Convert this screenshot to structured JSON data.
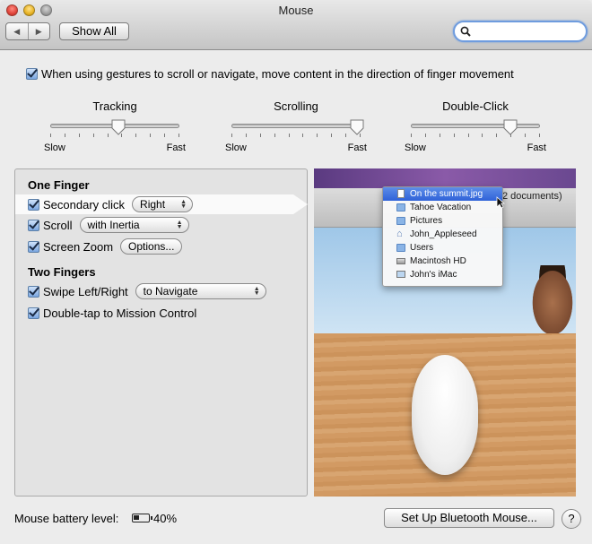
{
  "window": {
    "title": "Mouse",
    "show_all": "Show All",
    "back_glyph": "◀",
    "forward_glyph": "▶",
    "search_placeholder": ""
  },
  "natural_scroll": {
    "label": "When using gestures to scroll or navigate, move content in the direction of finger movement",
    "checked": true
  },
  "sliders": [
    {
      "title": "Tracking",
      "min_label": "Slow",
      "max_label": "Fast",
      "value_fraction": 0.53
    },
    {
      "title": "Scrolling",
      "min_label": "Slow",
      "max_label": "Fast",
      "value_fraction": 0.97
    },
    {
      "title": "Double-Click",
      "min_label": "Slow",
      "max_label": "Fast",
      "value_fraction": 0.77
    }
  ],
  "one_finger": {
    "heading": "One Finger",
    "secondary_click": {
      "label": "Secondary click",
      "value": "Right",
      "checked": true
    },
    "scroll": {
      "label": "Scroll",
      "value": "with Inertia",
      "checked": true
    },
    "screen_zoom": {
      "label": "Screen Zoom",
      "button": "Options...",
      "checked": true
    }
  },
  "two_fingers": {
    "heading": "Two Fingers",
    "swipe": {
      "label": "Swipe Left/Right",
      "value": "to Navigate",
      "checked": true
    },
    "double_tap": {
      "label": "Double-tap to Mission Control",
      "checked": true
    }
  },
  "preview": {
    "docs_text": "2 documents)",
    "menu_items": [
      {
        "label": "On the summit.jpg",
        "icon": "document-icon",
        "selected": true
      },
      {
        "label": "Tahoe Vacation",
        "icon": "folder-icon"
      },
      {
        "label": "Pictures",
        "icon": "folder-icon"
      },
      {
        "label": "John_Appleseed",
        "icon": "home-icon"
      },
      {
        "label": "Users",
        "icon": "folder-icon"
      },
      {
        "label": "Macintosh HD",
        "icon": "drive-icon"
      },
      {
        "label": "John's iMac",
        "icon": "computer-icon"
      }
    ]
  },
  "footer": {
    "battery_label": "Mouse battery level:",
    "battery_percent": "40%",
    "battery_level": 0.4,
    "bluetooth_button": "Set Up Bluetooth Mouse...",
    "help": "?"
  }
}
